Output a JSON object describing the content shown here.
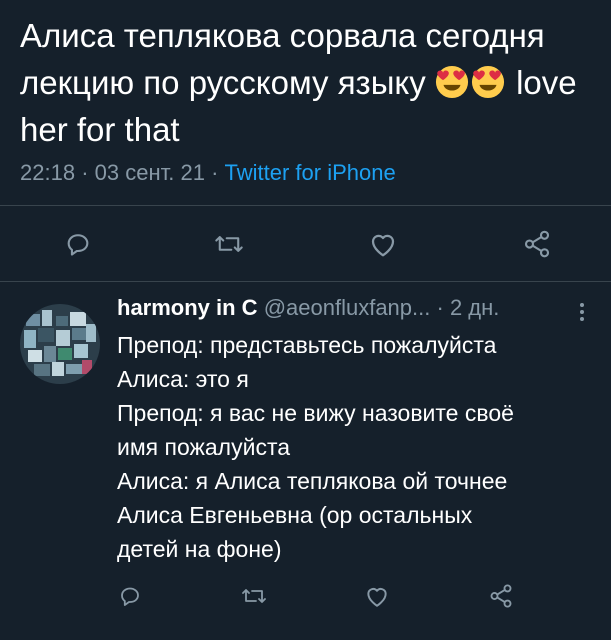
{
  "main_tweet": {
    "text_before": "Алиса теплякова сорвала сегодня лекцию по русскому языку",
    "emojis": [
      "heart-eyes-emoji",
      "heart-eyes-emoji"
    ],
    "text_after": "love her for that",
    "time": "22:18",
    "dot1": "·",
    "date": "03 сент. 21",
    "dot2": "·",
    "source": "Twitter for iPhone",
    "actions": [
      "reply-icon",
      "retweet-icon",
      "like-icon",
      "share-icon"
    ]
  },
  "reply": {
    "name": "harmony in C",
    "handle": "@aeonfluxfanp...",
    "sep": "·",
    "time": "2 дн.",
    "lines": [
      "Препод: представьтесь пожалуйста",
      "Алиса: это я",
      "Препод: я вас не вижу назовите своё",
      "имя пожалуйста",
      "Алиса: я Алиса теплякова ой точнее",
      "Алиса Евгеньевна (ор остальных",
      "детей на фоне)"
    ],
    "actions": [
      "reply-icon",
      "retweet-icon",
      "like-icon",
      "share-icon"
    ]
  },
  "colors": {
    "background": "#15202b",
    "text": "#ffffff",
    "secondary": "#8899a6",
    "link": "#1da1f2",
    "divider": "#38444d",
    "emoji_face": "#ffcc4d",
    "emoji_heart": "#dd2e44"
  }
}
